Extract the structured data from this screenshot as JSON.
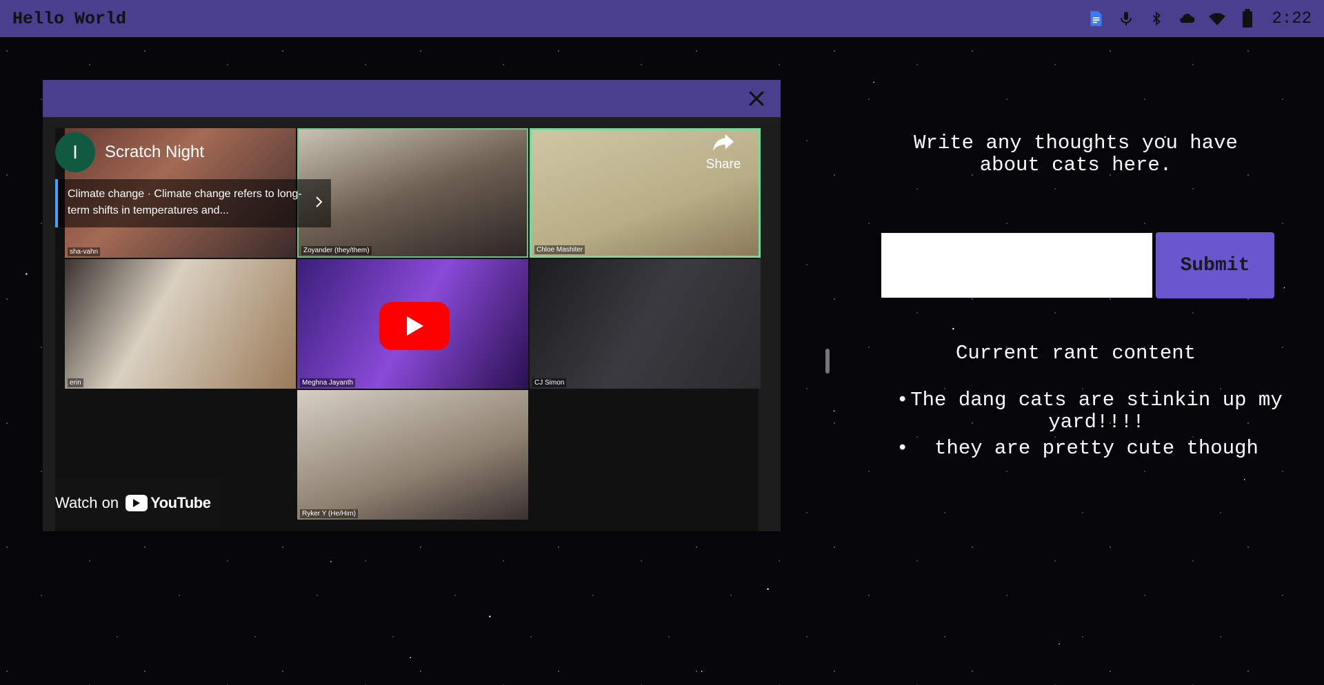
{
  "topbar": {
    "title": "Hello World",
    "clock": "2:22",
    "icons": [
      "docs-icon",
      "mic-icon",
      "bluetooth-icon",
      "cloud-icon",
      "wifi-icon",
      "battery-icon"
    ],
    "accent": "#4a3e8f"
  },
  "video": {
    "channel_initial": "I",
    "channel_title": "Scratch Night",
    "info_card": "Climate change · Climate change refers to long-term shifts in temperatures and...",
    "share_label": "Share",
    "watch_on_label": "Watch on",
    "youtube_label": "YouTube",
    "participants": [
      "sha-vahn",
      "Zoyander (they/them)",
      "Chloe Mashiter",
      "erin",
      "Meghna Jayanth",
      "CJ Simon",
      "Ryker Y (He/Him)"
    ]
  },
  "form": {
    "prompt": "Write any thoughts you have about cats here.",
    "input_value": "",
    "submit_label": "Submit",
    "button_color": "#6a57cf"
  },
  "rant": {
    "heading": "Current rant content",
    "items": [
      "The dang cats are stinkin up my yard!!!!",
      "they are pretty cute though"
    ]
  }
}
